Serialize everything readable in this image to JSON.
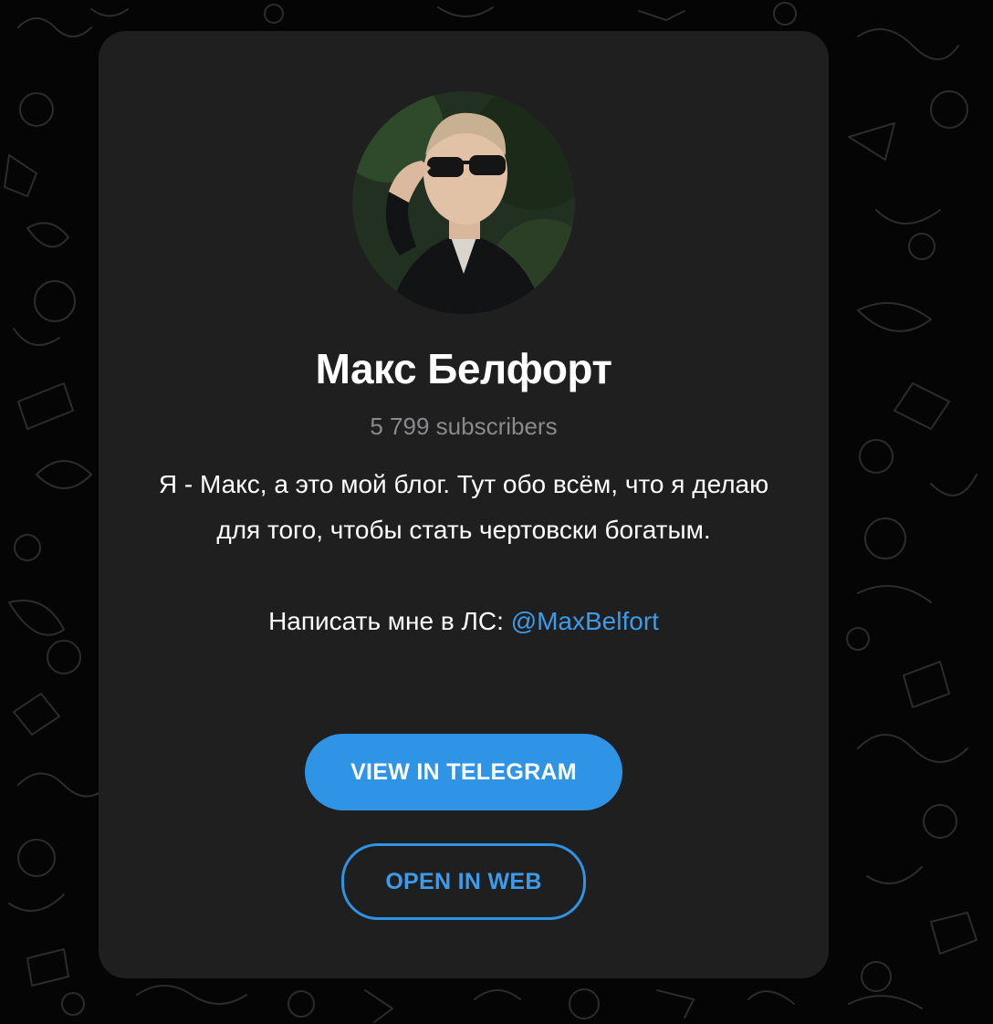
{
  "channel": {
    "title": "Макс Белфорт",
    "subscribers": "5 799 subscribers",
    "description_text": "Я - Макс, а это мой блог. Тут обо всём, что я делаю для того, чтобы стать чертовски богатым.",
    "contact_prefix": "Написать мне в ЛС: ",
    "contact_mention": "@MaxBelfort"
  },
  "buttons": {
    "view_in_telegram": "VIEW IN TELEGRAM",
    "open_in_web": "OPEN IN WEB"
  },
  "colors": {
    "accent": "#2f93e6",
    "link": "#3d9be9",
    "card_bg": "#1f1f20",
    "page_bg": "#050505",
    "muted_text": "#8a8a8e"
  },
  "icons": {
    "background_pattern": "doodle-pattern"
  }
}
